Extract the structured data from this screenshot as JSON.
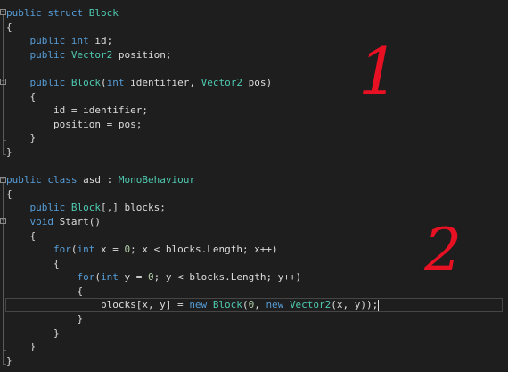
{
  "editor": {
    "lines": [
      [
        "public",
        " ",
        "struct",
        " ",
        "Block"
      ],
      [
        "{"
      ],
      [
        "    ",
        "public",
        " ",
        "int",
        " id;"
      ],
      [
        "    ",
        "public",
        " ",
        "Vector2",
        " position;"
      ],
      [
        ""
      ],
      [
        "    ",
        "public",
        " ",
        "Block",
        "(",
        "int",
        " identifier, ",
        "Vector2",
        " pos)"
      ],
      [
        "    {"
      ],
      [
        "        id = identifier;"
      ],
      [
        "        position = pos;"
      ],
      [
        "    }"
      ],
      [
        "}"
      ],
      [
        ""
      ],
      [
        "public",
        " ",
        "class",
        " asd : ",
        "MonoBehaviour"
      ],
      [
        "{"
      ],
      [
        "    ",
        "public",
        " ",
        "Block",
        "[,] blocks;"
      ],
      [
        "    ",
        "void",
        " Start()"
      ],
      [
        "    {"
      ],
      [
        "        ",
        "for",
        "(",
        "int",
        " x = ",
        "0",
        "; x < blocks.Length; x++)"
      ],
      [
        "        {"
      ],
      [
        "            ",
        "for",
        "(",
        "int",
        " y = ",
        "0",
        "; y < blocks.Length; y++)"
      ],
      [
        "            {"
      ],
      [
        "                blocks[x, y] = ",
        "new",
        " ",
        "Block",
        "(",
        "0",
        ", ",
        "new",
        " ",
        "Vector2",
        "(x, y));"
      ],
      [
        "            }"
      ],
      [
        "        }"
      ],
      [
        "    }"
      ],
      [
        "}"
      ]
    ]
  },
  "annotations": {
    "mark1": "1",
    "mark2": "2"
  },
  "colors": {
    "background": "#1e1e1e",
    "text": "#dcdcdc",
    "keyword": "#569cd6",
    "type": "#4ec9b0",
    "number": "#b5cea8",
    "annotation": "#e81123"
  }
}
